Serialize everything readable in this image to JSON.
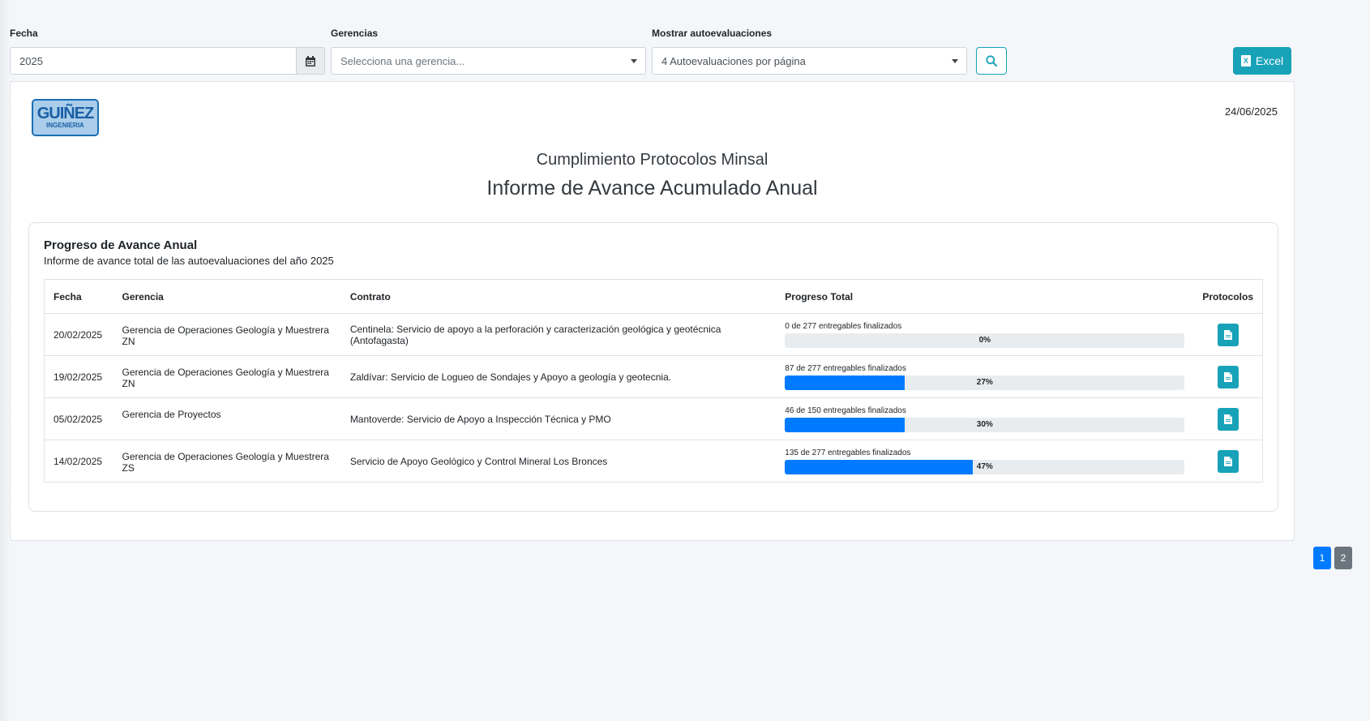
{
  "filters": {
    "fecha_label": "Fecha",
    "fecha_value": "2025",
    "gerencias_label": "Gerencias",
    "gerencias_placeholder": "Selecciona una gerencia...",
    "mostrar_label": "Mostrar autoevaluaciones",
    "mostrar_value": "4 Autoevaluaciones por página",
    "excel_label": "Excel"
  },
  "report": {
    "logo_line1": "GUIÑEZ",
    "logo_line2": "INGENIERIA",
    "date": "24/06/2025",
    "subtitle": "Cumplimiento Protocolos Minsal",
    "title": "Informe de Avance Acumulado Anual"
  },
  "card": {
    "title": "Progreso de Avance Anual",
    "description": "Informe de avance total de las autoevaluaciones del año 2025"
  },
  "table": {
    "headers": [
      "Fecha",
      "Gerencia",
      "Contrato",
      "Progreso Total",
      "Protocolos"
    ],
    "rows": [
      {
        "fecha": "20/02/2025",
        "gerencia": "Gerencia de Operaciones Geología y Muestrera ZN",
        "contrato": "Centinela: Servicio de apoyo a la perforación y caracterización geológica y geotécnica (Antofagasta)",
        "progreso_text": "0 de 277 entregables finalizados",
        "progreso_pct": "0%",
        "progreso_value": 0
      },
      {
        "fecha": "19/02/2025",
        "gerencia": "Gerencia de Operaciones Geología y Muestrera ZN",
        "contrato": "Zaldívar: Servicio de Logueo de Sondajes y Apoyo a geología y geotecnia.",
        "progreso_text": "87 de 277 entregables finalizados",
        "progreso_pct": "27%",
        "progreso_value": 30
      },
      {
        "fecha": "05/02/2025",
        "gerencia": "Gerencia de Proyectos",
        "contrato": "Mantoverde: Servicio de Apoyo a Inspección Técnica y PMO",
        "progreso_text": "46 de 150 entregables finalizados",
        "progreso_pct": "30%",
        "progreso_value": 30
      },
      {
        "fecha": "14/02/2025",
        "gerencia": "Gerencia de Operaciones Geología y Muestrera ZS",
        "contrato": "Servicio de Apoyo Geológico y Control Mineral Los Bronces",
        "progreso_text": "135 de 277 entregables finalizados",
        "progreso_pct": "47%",
        "progreso_value": 47
      }
    ]
  },
  "pagination": {
    "pages": [
      "1",
      "2"
    ],
    "active": "1"
  },
  "colors": {
    "primary": "#007bff",
    "info": "#17a2b8",
    "secondary": "#6c757d"
  },
  "icons": [
    "calendar-icon",
    "search-icon",
    "excel-file-icon",
    "document-icon"
  ]
}
